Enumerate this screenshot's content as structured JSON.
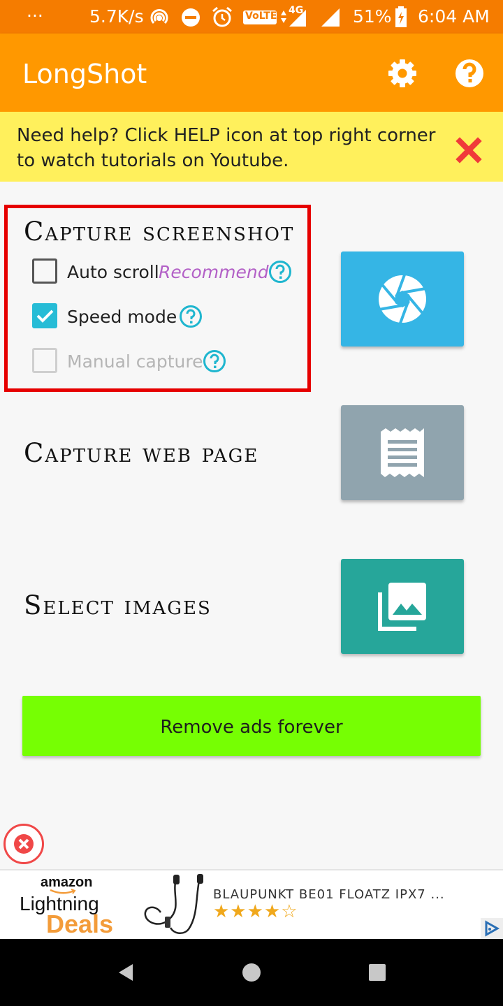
{
  "status_bar": {
    "dots": "···",
    "net_speed": "5.7K/s",
    "network_type": "4G",
    "volte": "VoLTE",
    "battery": "51%",
    "time": "6:04 AM",
    "icons": [
      "hotspot-icon",
      "dnd-icon",
      "alarm-icon",
      "volte-icon",
      "signal-icon",
      "battery-icon"
    ]
  },
  "app_bar": {
    "title": "LongShot",
    "icons": [
      "settings-gear-icon",
      "help-circle-icon"
    ]
  },
  "banner": {
    "line1": "Need help? Click HELP icon at top right corner",
    "line2": "to watch tutorials on Youtube.",
    "close_icon": "red-x-icon"
  },
  "capture_screenshot": {
    "title": "Capture screenshot",
    "options": [
      {
        "label": "Auto scroll",
        "tag": "Recommend",
        "checked": false,
        "enabled": true
      },
      {
        "label": "Speed mode",
        "checked": true,
        "enabled": true
      },
      {
        "label": "Manual capture",
        "checked": false,
        "enabled": false
      }
    ],
    "button_icon": "camera-shutter-icon",
    "button_color": "#35b5e5"
  },
  "capture_web_page": {
    "title": "Capture web page",
    "button_icon": "receipt-icon",
    "button_color": "#90a4ae"
  },
  "select_images": {
    "title": "Select images",
    "button_icon": "photo-library-icon",
    "button_color": "#26a69a"
  },
  "remove_ads": {
    "label": "Remove ads forever",
    "color": "#76ff03"
  },
  "ad": {
    "brand_top": "amazon",
    "brand_mid": "Lightning",
    "brand_bottom": "Deals",
    "product": "BLAUPUNKT BE01 FLOATZ IPX7 ...",
    "stars": "★★★★☆",
    "rating": 4
  },
  "nav_bar": {
    "icons": [
      "back-icon",
      "home-icon",
      "recents-icon"
    ]
  }
}
